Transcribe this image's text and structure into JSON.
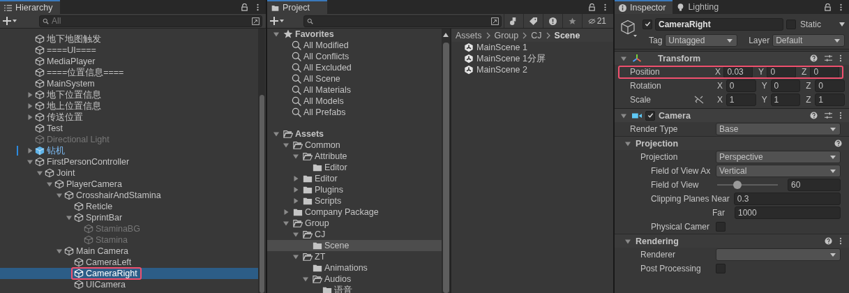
{
  "hierarchy": {
    "tab": {
      "label": "Hierarchy"
    },
    "search": {
      "placeholder": "All"
    },
    "items": [
      {
        "name": "地下地图触发",
        "kind": "object",
        "disabled": false,
        "selected": false,
        "annotated": false
      },
      {
        "name": "====UI====",
        "kind": "object",
        "disabled": false,
        "selected": false,
        "annotated": false
      },
      {
        "name": "MediaPlayer",
        "kind": "object",
        "disabled": false,
        "selected": false,
        "annotated": false
      },
      {
        "name": "====位置信息====",
        "kind": "object",
        "disabled": false,
        "selected": false,
        "annotated": false
      },
      {
        "name": "MainSystem",
        "kind": "object",
        "disabled": false,
        "selected": false,
        "annotated": false
      },
      {
        "name": "地下位置信息",
        "kind": "object",
        "expanded": false,
        "disabled": false,
        "selected": false,
        "annotated": false
      },
      {
        "name": "地上位置信息",
        "kind": "object",
        "expanded": false,
        "disabled": false,
        "selected": false,
        "annotated": false
      },
      {
        "name": "传送位置",
        "kind": "object",
        "expanded": false,
        "disabled": false,
        "selected": false,
        "annotated": false
      },
      {
        "name": "Test",
        "kind": "object",
        "disabled": false,
        "selected": false,
        "annotated": false
      },
      {
        "name": "Directional Light",
        "kind": "object",
        "disabled": true,
        "selected": false,
        "annotated": false
      },
      {
        "name": "钻机",
        "kind": "prefab",
        "expanded": false,
        "disabled": false,
        "selected": false,
        "annotated": false
      },
      {
        "name": "FirstPersonController",
        "kind": "object",
        "expanded": true,
        "disabled": false,
        "selected": false,
        "annotated": false,
        "children": [
          {
            "name": "Joint",
            "kind": "object",
            "expanded": true,
            "disabled": false,
            "selected": false,
            "annotated": false,
            "children": [
              {
                "name": "PlayerCamera",
                "kind": "object",
                "expanded": true,
                "disabled": false,
                "selected": false,
                "annotated": false,
                "children": [
                  {
                    "name": "CrosshairAndStamina",
                    "kind": "object",
                    "expanded": true,
                    "disabled": false,
                    "selected": false,
                    "annotated": false,
                    "children": [
                      {
                        "name": "Reticle",
                        "kind": "object",
                        "disabled": false,
                        "selected": false,
                        "annotated": false
                      },
                      {
                        "name": "SprintBar",
                        "kind": "object",
                        "expanded": true,
                        "disabled": false,
                        "selected": false,
                        "annotated": false,
                        "children": [
                          {
                            "name": "StaminaBG",
                            "kind": "object",
                            "disabled": true,
                            "selected": false,
                            "annotated": false
                          },
                          {
                            "name": "Stamina",
                            "kind": "object",
                            "disabled": true,
                            "selected": false,
                            "annotated": false
                          }
                        ]
                      }
                    ]
                  },
                  {
                    "name": "Main Camera",
                    "kind": "object",
                    "expanded": true,
                    "disabled": false,
                    "selected": false,
                    "annotated": false,
                    "children": [
                      {
                        "name": "CameraLeft",
                        "kind": "object",
                        "disabled": false,
                        "selected": false,
                        "annotated": false
                      },
                      {
                        "name": "CameraRight",
                        "kind": "object",
                        "disabled": false,
                        "selected": true,
                        "annotated": true
                      },
                      {
                        "name": "UICamera",
                        "kind": "object",
                        "disabled": false,
                        "selected": false,
                        "annotated": false
                      }
                    ]
                  }
                ]
              }
            ]
          }
        ]
      }
    ]
  },
  "project": {
    "tab": {
      "label": "Project"
    },
    "filter_count": "21",
    "favorites": {
      "label": "Favorites",
      "expanded": true,
      "items": [
        {
          "label": "All Modified"
        },
        {
          "label": "All Conflicts"
        },
        {
          "label": "All Excluded"
        },
        {
          "label": "All Scene"
        },
        {
          "label": "All Materials"
        },
        {
          "label": "All Models"
        },
        {
          "label": "All Prefabs"
        }
      ]
    },
    "assets": {
      "label": "Assets",
      "expanded": true,
      "selected": false,
      "children": [
        {
          "label": "Common",
          "expanded": true,
          "selected": false,
          "children": [
            {
              "label": "Attribute",
              "expanded": true,
              "selected": false,
              "children": [
                {
                  "label": "Editor",
                  "selected": false
                }
              ]
            },
            {
              "label": "Editor",
              "expanded": false,
              "selected": false
            },
            {
              "label": "Plugins",
              "expanded": false,
              "selected": false
            },
            {
              "label": "Scripts",
              "expanded": false,
              "selected": false
            }
          ]
        },
        {
          "label": "Company Package",
          "expanded": false,
          "selected": false
        },
        {
          "label": "Group",
          "expanded": true,
          "selected": false,
          "children": [
            {
              "label": "CJ",
              "expanded": true,
              "selected": false,
              "children": [
                {
                  "label": "Scene",
                  "selected": true
                }
              ]
            },
            {
              "label": "ZT",
              "expanded": true,
              "selected": false,
              "children": [
                {
                  "label": "Animations",
                  "selected": false
                },
                {
                  "label": "Audios",
                  "expanded": true,
                  "selected": false,
                  "children": [
                    {
                      "label": "语音",
                      "selected": false
                    }
                  ]
                }
              ]
            }
          ]
        }
      ]
    },
    "breadcrumb": [
      {
        "label": "Assets",
        "current": false
      },
      {
        "label": "Group",
        "current": false
      },
      {
        "label": "CJ",
        "current": false
      },
      {
        "label": "Scene",
        "current": true
      }
    ],
    "files": [
      {
        "name": "MainScene 1"
      },
      {
        "name": "MainScene 1分屏"
      },
      {
        "name": "MainScene 2"
      }
    ]
  },
  "inspector": {
    "tabs": [
      {
        "label": "Inspector",
        "kind": "info",
        "selected": true
      },
      {
        "label": "Lighting",
        "kind": "bulb",
        "selected": false
      }
    ],
    "object": {
      "active": true,
      "name": "CameraRight",
      "static": false,
      "static_label": "Static",
      "tag_label": "Tag",
      "tag": "Untagged",
      "layer_label": "Layer",
      "layer": "Default"
    },
    "transform": {
      "title": "Transform",
      "expanded": true,
      "rows": [
        {
          "label": "Position",
          "annotated": true,
          "values": [
            {
              "axis": "X",
              "value": "0.03"
            },
            {
              "axis": "Y",
              "value": "0"
            },
            {
              "axis": "Z",
              "value": "0"
            }
          ]
        },
        {
          "label": "Rotation",
          "annotated": false,
          "values": [
            {
              "axis": "X",
              "value": "0"
            },
            {
              "axis": "Y",
              "value": "0"
            },
            {
              "axis": "Z",
              "value": "0"
            }
          ]
        },
        {
          "label": "Scale",
          "annotated": false,
          "linked": true,
          "values": [
            {
              "axis": "X",
              "value": "1"
            },
            {
              "axis": "Y",
              "value": "1"
            },
            {
              "axis": "Z",
              "value": "1"
            }
          ]
        }
      ]
    },
    "camera": {
      "title": "Camera",
      "expanded": true,
      "enabled": true,
      "fields": [
        {
          "kind": "dropdown",
          "label": "Render Type",
          "value": "Base"
        }
      ],
      "sections": [
        {
          "title": "Projection",
          "expanded": true,
          "fields": [
            {
              "kind": "dropdown",
              "label": "Projection",
              "value": "Perspective",
              "children": [
                {
                  "kind": "dropdown",
                  "label": "Field of View Ax",
                  "value": "Vertical"
                },
                {
                  "kind": "slider",
                  "label": "Field of View",
                  "level": 0.33,
                  "value": "60"
                },
                {
                  "kind": "number",
                  "label": "Clipping Planes Near",
                  "value": "0.3"
                },
                {
                  "kind": "subnumber",
                  "label": "Far",
                  "value": "1000"
                },
                {
                  "kind": "checkbox",
                  "label": "Physical Camer",
                  "checked": false
                }
              ]
            }
          ]
        },
        {
          "title": "Rendering",
          "expanded": true,
          "fields": [
            {
              "kind": "dropdown",
              "label": "Renderer"
            },
            {
              "kind": "checkbox",
              "label": "Post Processing",
              "checked": false
            }
          ]
        }
      ]
    }
  }
}
